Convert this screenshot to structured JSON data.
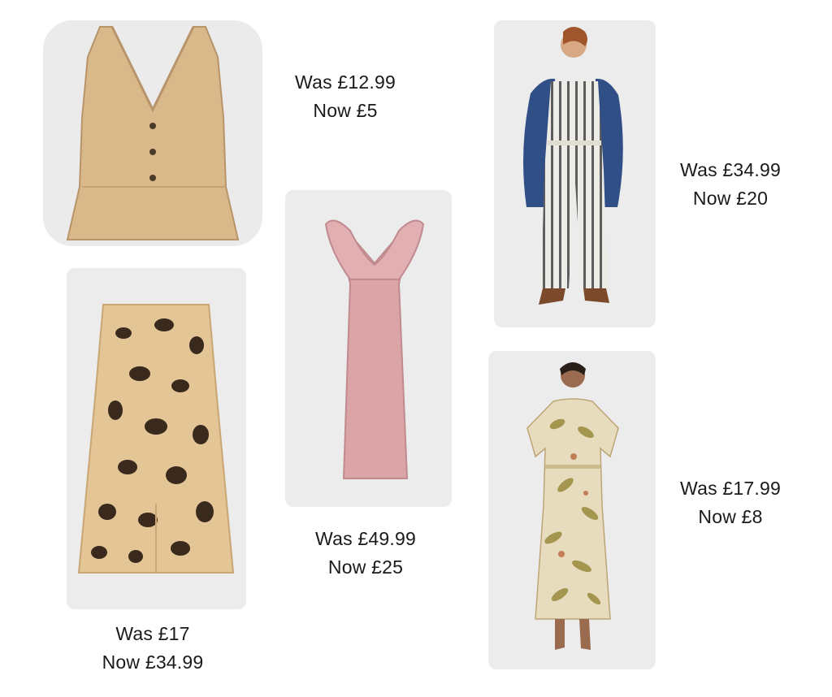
{
  "products": [
    {
      "item": "beige-v-neck-top",
      "was": "Was £12.99",
      "now": "Now £5"
    },
    {
      "item": "leopard-print-skirt",
      "was": "Was £17",
      "now": "Now £34.99"
    },
    {
      "item": "pink-ruffle-dress",
      "was": "Was £49.99",
      "now": "Now £25"
    },
    {
      "item": "striped-jumpsuit",
      "was": "Was £34.99",
      "now": "Now £20"
    },
    {
      "item": "tropical-print-dress",
      "was": "Was £17.99",
      "now": "Now £8"
    }
  ]
}
